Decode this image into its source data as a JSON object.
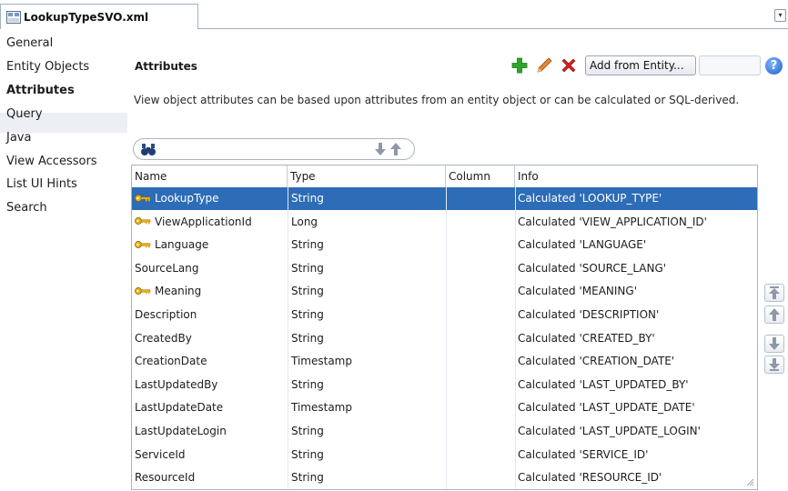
{
  "tab": {
    "label": "LookupTypeSVO.xml"
  },
  "sidebar": {
    "items": [
      {
        "label": "General"
      },
      {
        "label": "Entity Objects"
      },
      {
        "label": "Attributes"
      },
      {
        "label": "Query"
      },
      {
        "label": "Java"
      },
      {
        "label": "View Accessors"
      },
      {
        "label": "List UI Hints"
      },
      {
        "label": "Search"
      }
    ],
    "active_index": 2
  },
  "section": {
    "title": "Attributes",
    "description": "View object attributes can be based upon attributes from an entity object or can be calculated or SQL-derived."
  },
  "toolbar": {
    "add_icon": "green-plus-icon",
    "edit_icon": "pencil-icon",
    "delete_icon": "red-x-icon",
    "add_from_entity_label": "Add from Entity...",
    "second_button_label": "",
    "help_label": "?"
  },
  "search": {
    "value": "",
    "placeholder": ""
  },
  "table": {
    "columns": [
      "Name",
      "Type",
      "Column",
      "Info"
    ],
    "rows": [
      {
        "name": "LookupType",
        "type": "String",
        "column": "",
        "info": "Calculated 'LOOKUP_TYPE'",
        "key": true,
        "selected": true
      },
      {
        "name": "ViewApplicationId",
        "type": "Long",
        "column": "",
        "info": "Calculated 'VIEW_APPLICATION_ID'",
        "key": true,
        "selected": false
      },
      {
        "name": "Language",
        "type": "String",
        "column": "",
        "info": "Calculated 'LANGUAGE'",
        "key": true,
        "selected": false
      },
      {
        "name": "SourceLang",
        "type": "String",
        "column": "",
        "info": "Calculated 'SOURCE_LANG'",
        "key": false,
        "selected": false
      },
      {
        "name": "Meaning",
        "type": "String",
        "column": "",
        "info": "Calculated 'MEANING'",
        "key": true,
        "selected": false
      },
      {
        "name": "Description",
        "type": "String",
        "column": "",
        "info": "Calculated 'DESCRIPTION'",
        "key": false,
        "selected": false
      },
      {
        "name": "CreatedBy",
        "type": "String",
        "column": "",
        "info": "Calculated 'CREATED_BY'",
        "key": false,
        "selected": false
      },
      {
        "name": "CreationDate",
        "type": "Timestamp",
        "column": "",
        "info": "Calculated 'CREATION_DATE'",
        "key": false,
        "selected": false
      },
      {
        "name": "LastUpdatedBy",
        "type": "String",
        "column": "",
        "info": "Calculated 'LAST_UPDATED_BY'",
        "key": false,
        "selected": false
      },
      {
        "name": "LastUpdateDate",
        "type": "Timestamp",
        "column": "",
        "info": "Calculated 'LAST_UPDATE_DATE'",
        "key": false,
        "selected": false
      },
      {
        "name": "LastUpdateLogin",
        "type": "String",
        "column": "",
        "info": "Calculated 'LAST_UPDATE_LOGIN'",
        "key": false,
        "selected": false
      },
      {
        "name": "ServiceId",
        "type": "String",
        "column": "",
        "info": "Calculated 'SERVICE_ID'",
        "key": false,
        "selected": false
      },
      {
        "name": "ResourceId",
        "type": "String",
        "column": "",
        "info": "Calculated 'RESOURCE_ID'",
        "key": false,
        "selected": false
      }
    ]
  },
  "reorder_buttons": [
    "move-to-top-icon",
    "move-up-icon",
    "move-down-icon",
    "move-to-bottom-icon"
  ],
  "colors": {
    "selection": "#2d6cb6",
    "key_icon": "#e8b21a",
    "add": "#2fa52b",
    "delete": "#d21f1f",
    "border": "#a9b4c2"
  }
}
